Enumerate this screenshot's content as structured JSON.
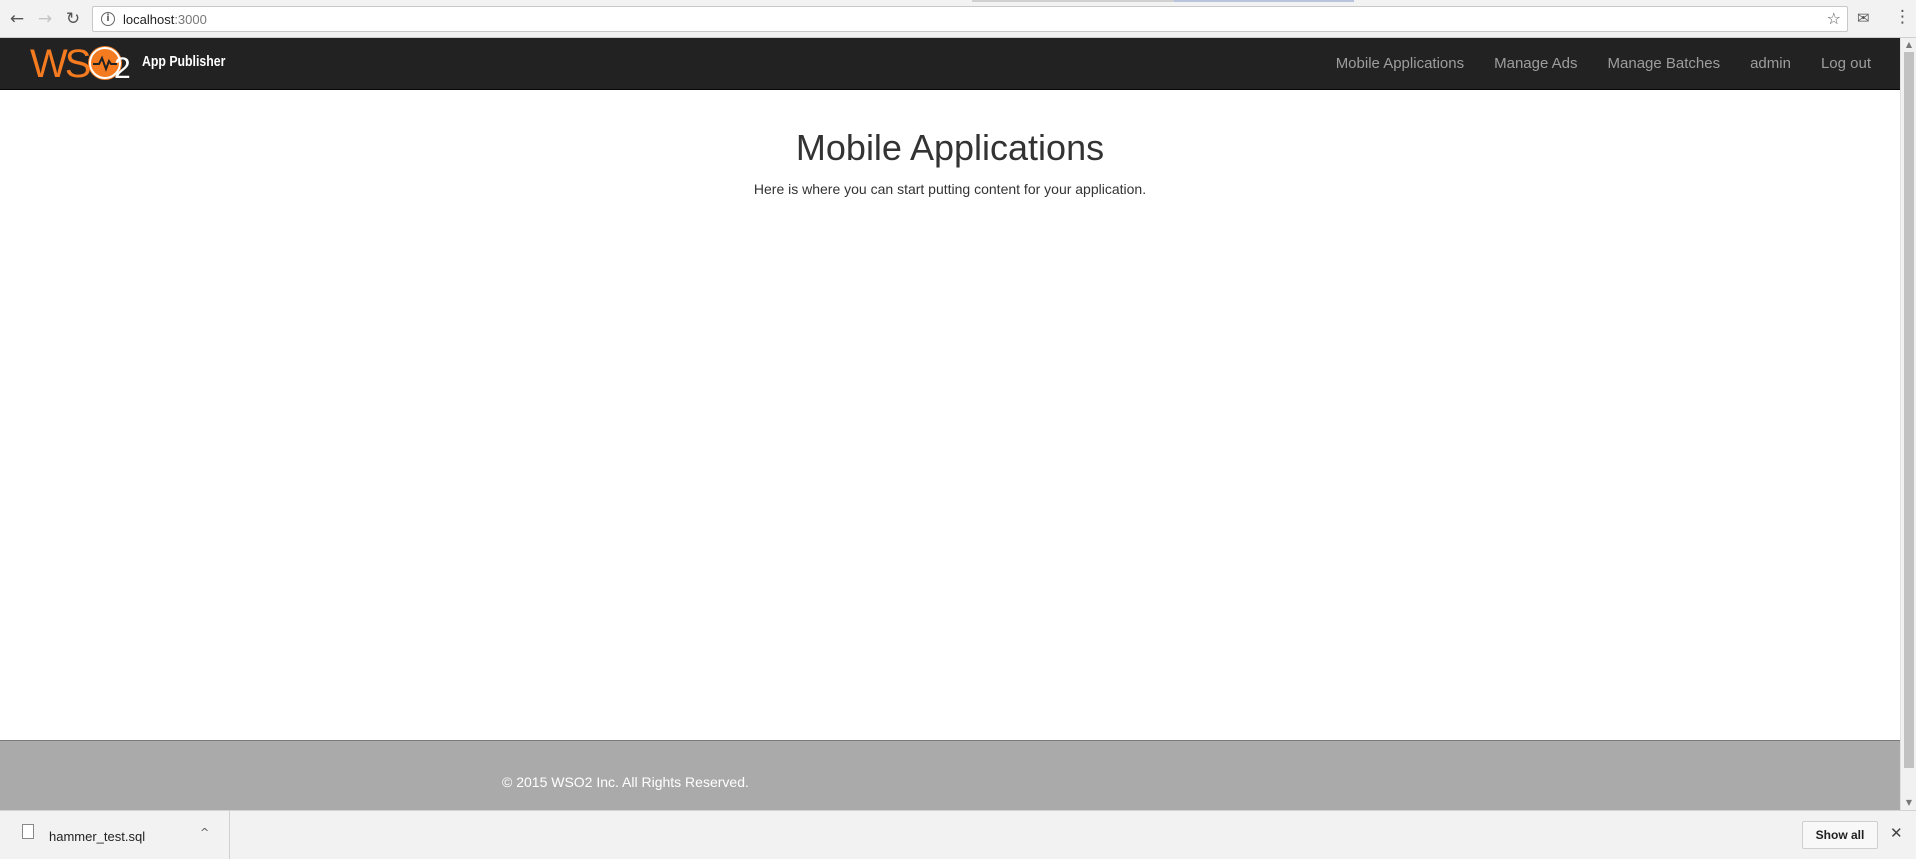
{
  "browser": {
    "url_host": "localhost",
    "url_port": ":3000",
    "back_icon": "←",
    "forward_icon": "→",
    "reload_icon": "↻",
    "info_icon": "i",
    "star_icon": "☆",
    "mail_icon": "✉",
    "menu_icon": "⋮"
  },
  "navbar": {
    "logo_text": "WSO2",
    "brand_name": "App Publisher",
    "links": [
      "Mobile Applications",
      "Manage Ads",
      "Manage Batches",
      "admin",
      "Log out"
    ]
  },
  "main": {
    "heading": "Mobile Applications",
    "subtext": "Here is where you can start putting content for your application."
  },
  "footer": {
    "copyright": "© 2015 WSO2 Inc. All Rights Reserved."
  },
  "downloads": {
    "file_name": "hammer_test.sql",
    "show_all_label": "Show all",
    "close_icon": "✕",
    "chevron_icon": "^"
  },
  "colors": {
    "navbar_bg": "#222222",
    "brand_orange": "#f47b20",
    "footer_bg": "#aaaaaa"
  }
}
